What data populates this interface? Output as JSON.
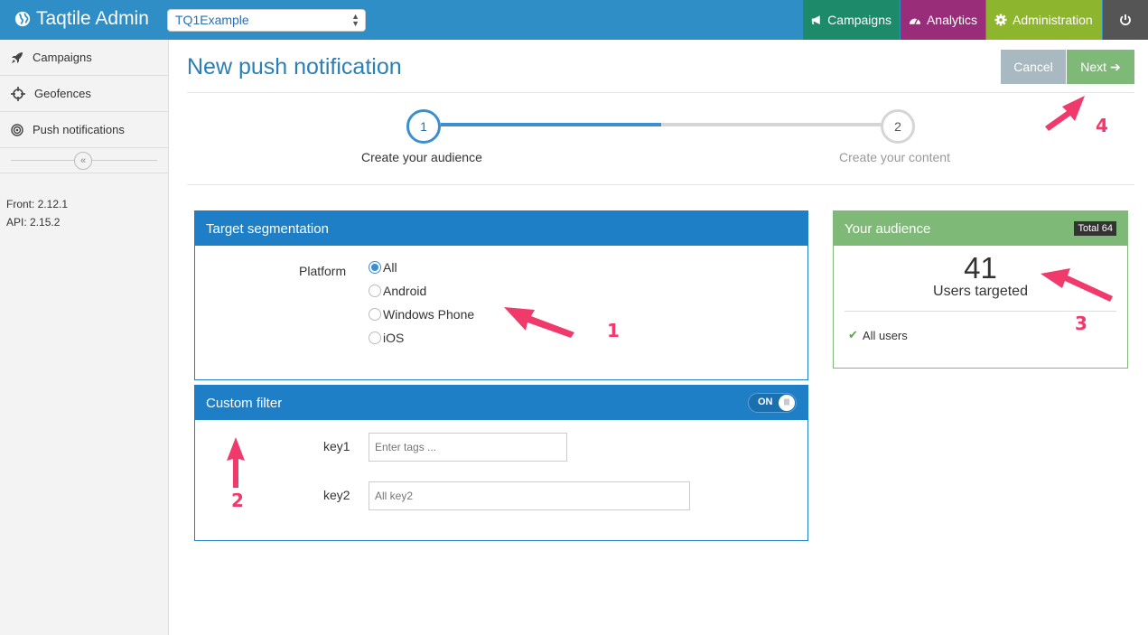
{
  "brand": {
    "name": "Taqtile Admin"
  },
  "app_select": {
    "value": "TQ1Example"
  },
  "topnav": [
    {
      "label": "Campaigns",
      "icon": "bullhorn-icon",
      "color": "#1d8a6a"
    },
    {
      "label": "Analytics",
      "icon": "dashboard-icon",
      "color": "#9a2d79"
    },
    {
      "label": "Administration",
      "icon": "gear-icon",
      "color": "#8eb52e"
    }
  ],
  "sidebar": {
    "items": [
      {
        "label": "Campaigns",
        "icon": "rocket-icon"
      },
      {
        "label": "Geofences",
        "icon": "crosshair-icon"
      },
      {
        "label": "Push notifications",
        "icon": "target-icon"
      }
    ],
    "front_version": "Front: 2.12.1",
    "api_version": "API: 2.15.2"
  },
  "page": {
    "title": "New push notification",
    "cancel_label": "Cancel",
    "next_label": "Next"
  },
  "stepper": {
    "steps": [
      {
        "number": "1",
        "label": "Create your audience",
        "active": true
      },
      {
        "number": "2",
        "label": "Create your content",
        "active": false
      }
    ]
  },
  "target_segmentation": {
    "title": "Target segmentation",
    "platform_label": "Platform",
    "options": [
      "All",
      "Android",
      "Windows Phone",
      "iOS"
    ],
    "selected": "All"
  },
  "custom_filter": {
    "title": "Custom filter",
    "toggle_label": "ON",
    "fields": [
      {
        "label": "key1",
        "placeholder": "Enter tags ..."
      },
      {
        "label": "key2",
        "placeholder": "All key2"
      }
    ]
  },
  "audience": {
    "title": "Your audience",
    "total_badge": "Total 64",
    "count": "41",
    "count_label": "Users targeted",
    "filter_summary": "All users"
  },
  "annotations": [
    "1",
    "2",
    "3",
    "4"
  ],
  "colors": {
    "topbar": "#2f8ec6",
    "panel_blue": "#1f7fc6",
    "audience_green": "#7fb978",
    "annotation": "#ef3a6b"
  }
}
